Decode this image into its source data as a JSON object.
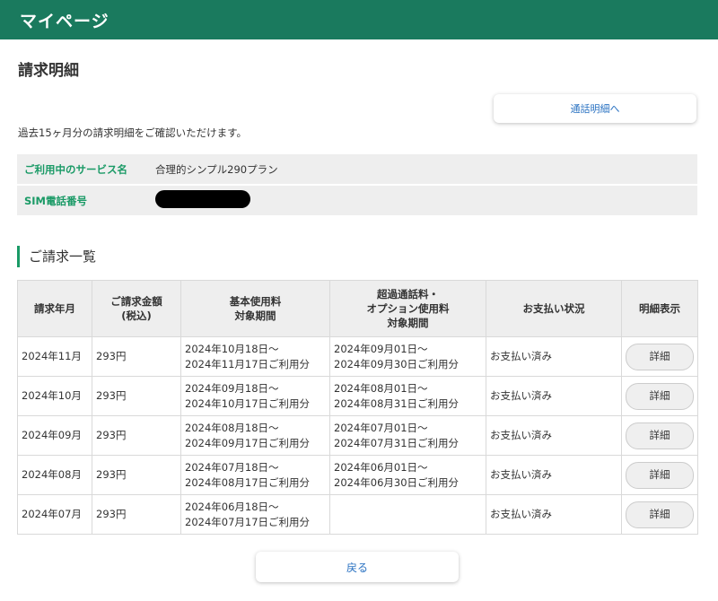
{
  "header": {
    "title": "マイページ"
  },
  "page": {
    "title": "請求明細",
    "call_detail_button": "通話明細へ",
    "intro": "過去15ヶ月分の請求明細をご確認いただけます。"
  },
  "info": {
    "service_label": "ご利用中のサービス名",
    "service_value": "合理的シンプル290プラン",
    "sim_label": "SIM電話番号"
  },
  "section": {
    "title": "ご請求一覧"
  },
  "table": {
    "headers": [
      "請求年月",
      "ご請求金額\n(税込)",
      "基本使用料\n対象期間",
      "超過通話料・\nオプション使用料\n対象期間",
      "お支払い状況",
      "明細表示"
    ],
    "rows": [
      {
        "month": "2024年11月",
        "amount": "293円",
        "basic": "2024年10月18日〜\n2024年11月17日ご利用分",
        "extra": "2024年09月01日〜\n2024年09月30日ご利用分",
        "status": "お支払い済み",
        "detail": "詳細"
      },
      {
        "month": "2024年10月",
        "amount": "293円",
        "basic": "2024年09月18日〜\n2024年10月17日ご利用分",
        "extra": "2024年08月01日〜\n2024年08月31日ご利用分",
        "status": "お支払い済み",
        "detail": "詳細"
      },
      {
        "month": "2024年09月",
        "amount": "293円",
        "basic": "2024年08月18日〜\n2024年09月17日ご利用分",
        "extra": "2024年07月01日〜\n2024年07月31日ご利用分",
        "status": "お支払い済み",
        "detail": "詳細"
      },
      {
        "month": "2024年08月",
        "amount": "293円",
        "basic": "2024年07月18日〜\n2024年08月17日ご利用分",
        "extra": "2024年06月01日〜\n2024年06月30日ご利用分",
        "status": "お支払い済み",
        "detail": "詳細"
      },
      {
        "month": "2024年07月",
        "amount": "293円",
        "basic": "2024年06月18日〜\n2024年07月17日ご利用分",
        "extra": "",
        "status": "お支払い済み",
        "detail": "詳細"
      }
    ]
  },
  "footer": {
    "back_button": "戻る"
  },
  "colors": {
    "header_bg": "#1a7a5e",
    "accent": "#1a9a66",
    "link": "#2a72c2"
  }
}
